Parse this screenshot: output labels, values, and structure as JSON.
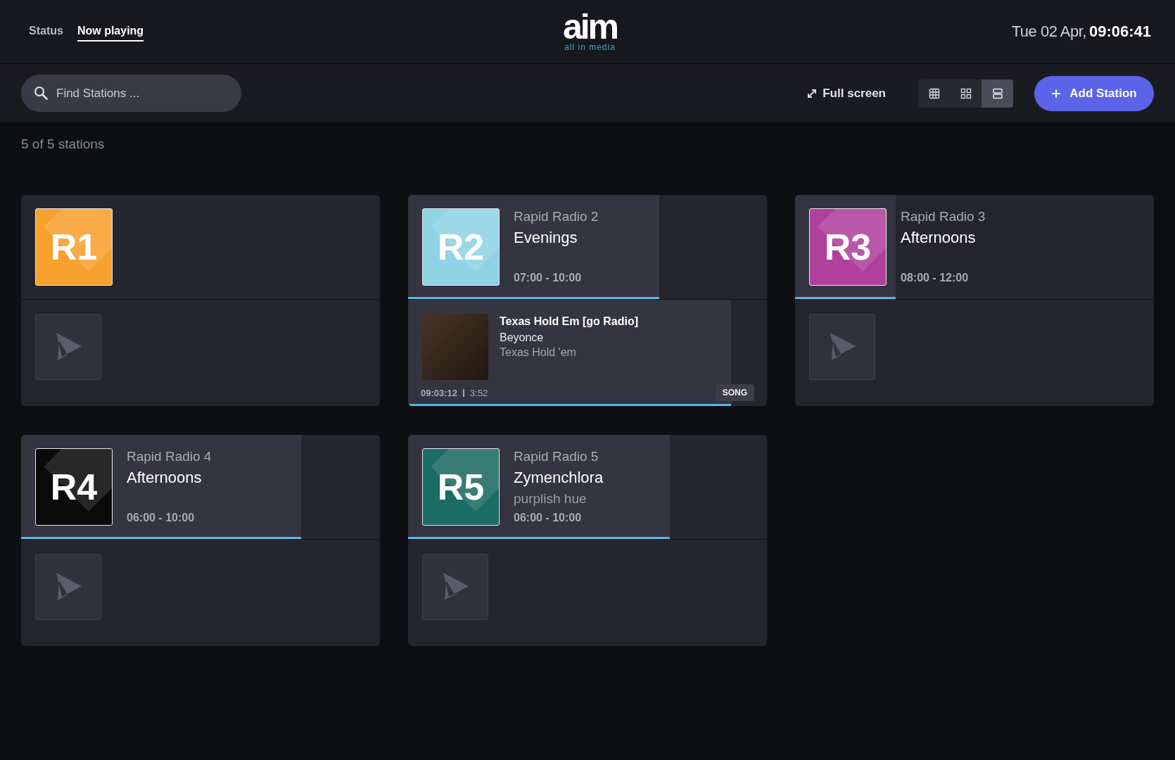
{
  "nav": {
    "tabs": [
      {
        "label": "Status",
        "selected": false
      },
      {
        "label": "Now playing",
        "selected": true
      }
    ]
  },
  "logo": {
    "wordmark": "aim",
    "tagline": "all in media"
  },
  "clock": {
    "date": "Tue 02 Apr,",
    "time": "09:06:41"
  },
  "toolbar": {
    "search": {
      "placeholder": "Find Stations ..."
    },
    "fullscreen": "Full screen",
    "views": [
      {
        "kind": "table",
        "selected": false
      },
      {
        "kind": "grid",
        "selected": false
      },
      {
        "kind": "list",
        "selected": true
      }
    ],
    "add_button": "Add Station"
  },
  "count": "5 of 5 stations",
  "stations": [
    {
      "badge": "R1",
      "color": "#f7a12e"
    },
    {
      "badge": "R2",
      "color": "#8fd3e4",
      "name": "Rapid Radio 2",
      "show": {
        "title": "Evenings",
        "times": "07:00 - 10:00",
        "level": 0.7
      },
      "now_playing": {
        "title": "Texas Hold Em [go Radio]",
        "artist": "Beyonce",
        "album": "Texas Hold 'em",
        "start": "09:03:12",
        "duration": "3:52",
        "type": "SONG",
        "level": 0.9
      }
    },
    {
      "badge": "R3",
      "color": "#b0409c",
      "name": "Rapid Radio 3",
      "show": {
        "title": "Afternoons",
        "times": "08:00 - 12:00",
        "level": 0.28
      }
    },
    {
      "badge": "R4",
      "color": "#0b0b0b",
      "name": "Rapid Radio 4",
      "show": {
        "title": "Afternoons",
        "times": "06:00 - 10:00",
        "level": 0.78
      }
    },
    {
      "badge": "R5",
      "color": "#1c6b64",
      "name": "Rapid Radio 5",
      "show": {
        "title": "Zymenchlora",
        "subtitle": "purplish hue",
        "times": "06:00 - 10:00",
        "level": 0.73
      }
    }
  ]
}
